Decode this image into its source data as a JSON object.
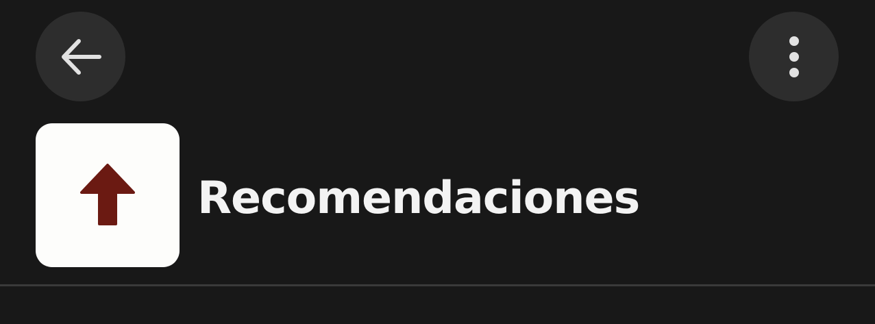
{
  "toolbar": {
    "back_icon": "arrow-left-icon",
    "more_icon": "more-vertical-icon"
  },
  "header": {
    "app_icon": "arrow-up-icon",
    "title": "Recomendaciones"
  },
  "colors": {
    "background": "#181818",
    "button_background": "#2d2d2d",
    "icon_tile": "#fdfdfb",
    "arrow": "#6b1a12",
    "title_text": "#f3f3f3",
    "divider": "#3a3a3a"
  }
}
